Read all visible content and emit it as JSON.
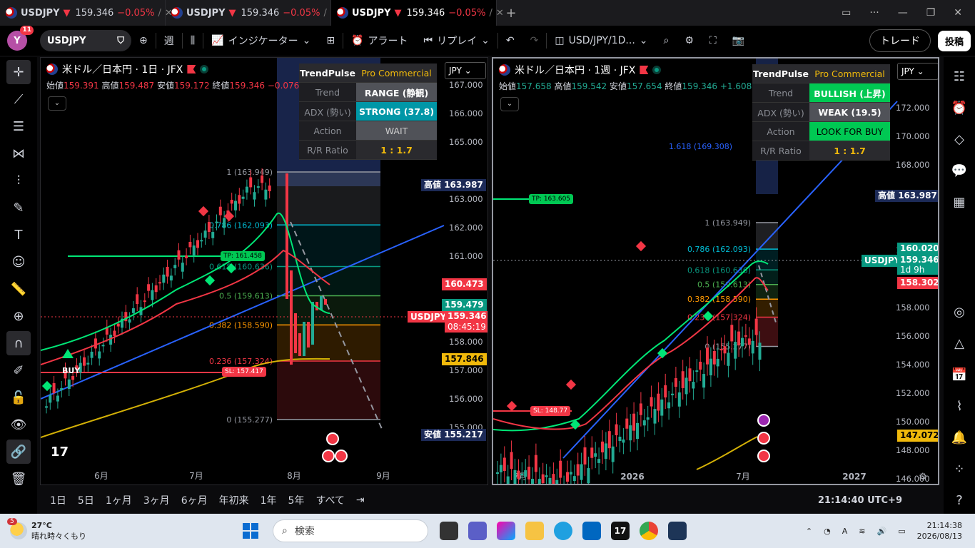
{
  "tabs": [
    {
      "symbol": "USDJPY",
      "arrow": "▼",
      "price": "159.346",
      "change": "−0.05%",
      "sep": "/"
    },
    {
      "symbol": "USDJPY",
      "arrow": "▼",
      "price": "159.346",
      "change": "−0.05%",
      "sep": "/"
    },
    {
      "symbol": "USDJPY",
      "arrow": "▼",
      "price": "159.346",
      "change": "−0.05%",
      "sep": "/"
    }
  ],
  "new_tab": "+",
  "toolbar": {
    "avatar": "Y",
    "avatar_badge": "11",
    "symbol": "USDJPY",
    "interval": "週",
    "indicators": "インジケーター",
    "alert": "アラート",
    "replay": "リプレイ",
    "layout": "USD/JPY/1D...",
    "trade": "トレード",
    "post": "投稿"
  },
  "chart1": {
    "title": "米ドル／日本円 · 1日 · JFX",
    "ohlc": [
      {
        "k": "始値",
        "v": "159.391"
      },
      {
        "k": "高値",
        "v": "159.487"
      },
      {
        "k": "安値",
        "v": "159.172"
      },
      {
        "k": "終値",
        "v": "159.346"
      }
    ],
    "change": "−0.076 (−0.05%)",
    "currency": "JPY",
    "panel": {
      "header": [
        "TrendPulse",
        "Pro Commercial"
      ],
      "rows": [
        [
          "Trend",
          "RANGE (静観)"
        ],
        [
          "ADX (勢い)",
          "STRONG (37.8)"
        ],
        [
          "Action",
          "WAIT"
        ],
        [
          "R/R Ratio",
          "1 : 1.7"
        ]
      ]
    },
    "axis": [
      "167.000",
      "166.000",
      "165.000",
      "163.000",
      "162.000",
      "161.000",
      "160.000",
      "159.000",
      "158.000",
      "157.000",
      "156.000",
      "155.000"
    ],
    "x_labels": [
      "6月",
      "7月",
      "8月",
      "9月"
    ],
    "fib": [
      "1 (163.949)",
      "0.786 (162.093)",
      "0.618 (160.636)",
      "0.5 (159.613)",
      "0.382 (158.590)",
      "0.236 (157.324)",
      "0 (155.277)"
    ],
    "tags": {
      "high": "高値",
      "high_v": "163.987",
      "low": "安値",
      "low_v": "155.217",
      "p1": "160.473",
      "p2": "159.479",
      "sym": "USDJPY",
      "cur": "159.346",
      "cd": "08:45:19",
      "p3": "157.846"
    },
    "tp": "TP: 161.458",
    "sl": "SL: 157.417",
    "buy": "BUY"
  },
  "chart2": {
    "title": "米ドル／日本円 · 1週 · JFX",
    "ohlc": [
      {
        "k": "始値",
        "v": "157.658"
      },
      {
        "k": "高値",
        "v": "159.542"
      },
      {
        "k": "安値",
        "v": "157.654"
      },
      {
        "k": "終値",
        "v": "159.346"
      }
    ],
    "change": "+1.608 (+1.02%)",
    "currency": "JPY",
    "panel": {
      "header": [
        "TrendPulse",
        "Pro Commercial"
      ],
      "rows": [
        [
          "Trend",
          "BULLISH (上昇)"
        ],
        [
          "ADX (勢い)",
          "WEAK (19.5)"
        ],
        [
          "Action",
          "LOOK FOR BUY"
        ],
        [
          "R/R Ratio",
          "1 : 1.7"
        ]
      ]
    },
    "axis": [
      "172.000",
      "170.000",
      "168.000",
      "166.000",
      "162.000",
      "158.000",
      "156.000",
      "154.000",
      "152.000",
      "150.000",
      "148.000",
      "146.000"
    ],
    "x_labels": [
      "7月",
      "2026",
      "7月",
      "2027"
    ],
    "fib": [
      "1.618 (169.308)",
      "1 (163.949)",
      "0.786 (162.093)",
      "0.618 (160.636)",
      "0.5 (159.613)",
      "0.382 (158.590)",
      "0.236 (157.324)",
      "0 (155.277)"
    ],
    "tags": {
      "high": "高値",
      "high_v": "163.987",
      "p1": "160.020",
      "sym": "USDJPY",
      "cur": "159.346",
      "cd": "1d 9h",
      "p2": "158.302",
      "p3": "147.072"
    },
    "tp": "TP: 163.605",
    "sl": "SL: 148.77"
  },
  "ranges": [
    "1日",
    "5日",
    "1ヶ月",
    "3ヶ月",
    "6ヶ月",
    "年初来",
    "1年",
    "5年",
    "すべて"
  ],
  "clock": "21:14:40 UTC+9",
  "taskbar": {
    "temp": "27°C",
    "weather": "晴れ時々くもり",
    "weather_badge": "5",
    "search": "検索",
    "time": "21:14:38",
    "date": "2026/08/13"
  },
  "colors": {
    "up": "#22ab94",
    "down": "#f23645",
    "accent": "#2962ff",
    "gold": "#f0b90b"
  }
}
